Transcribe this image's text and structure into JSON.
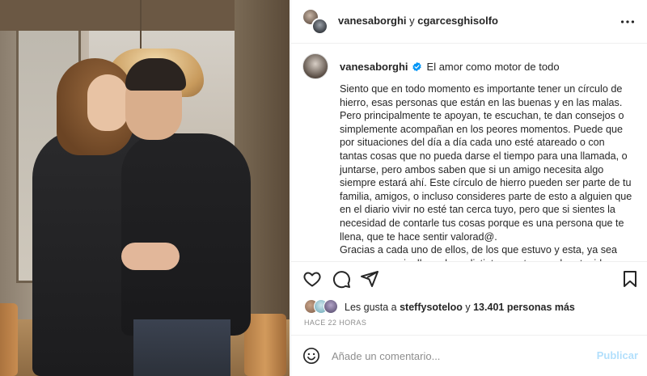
{
  "header": {
    "user1": "vanesaborghi",
    "connector": " y ",
    "user2": "cgarcesghisolfo",
    "more_icon": "more-horizontal-icon"
  },
  "post": {
    "author": "vanesaborghi",
    "verified_icon": "verified-badge-icon",
    "headline": "El amor como motor de todo",
    "caption": "Siento que en todo momento es importante tener un círculo de hierro, esas personas que están en las buenas y en las malas. Pero principalmente te apoyan, te escuchan, te dan consejos o simplemente acompañan en los peores momentos. Puede que por situaciones del día a día cada uno esté atareado o con tantas cosas que no pueda darse el tiempo para una llamada, o juntarse, pero ambos saben que si un amigo necesita algo siempre estará ahí. Este círculo de hierro pueden ser parte de tu familia, amigos, o incluso consideres parte de esto a alguien que en el diario vivir no esté tan cerca tuyo, pero que si sientes la necesidad de contarle tus cosas porque es una persona que te llena, que te hace sentir valorad@.\nGracias a cada uno de ellos, de los que estuvo y esta, ya sea con un mensaje, llamada, o distintos gestos que han tenido con"
  },
  "actions": {
    "like_icon": "heart-icon",
    "comment_icon": "comment-icon",
    "share_icon": "share-icon",
    "save_icon": "bookmark-icon"
  },
  "likes": {
    "prefix": "Les gusta a ",
    "user": "steffysoteloo",
    "middle": " y ",
    "count": "13.401 personas más"
  },
  "timestamp": "HACE 22 HORAS",
  "comment": {
    "placeholder": "Añade un comentario...",
    "emoji_icon": "smiley-icon",
    "publish_label": "Publicar"
  },
  "colors": {
    "verified": "#0095f6",
    "publish_disabled": "#b2dffc",
    "text": "#262626",
    "secondary": "#8e8e8e"
  }
}
